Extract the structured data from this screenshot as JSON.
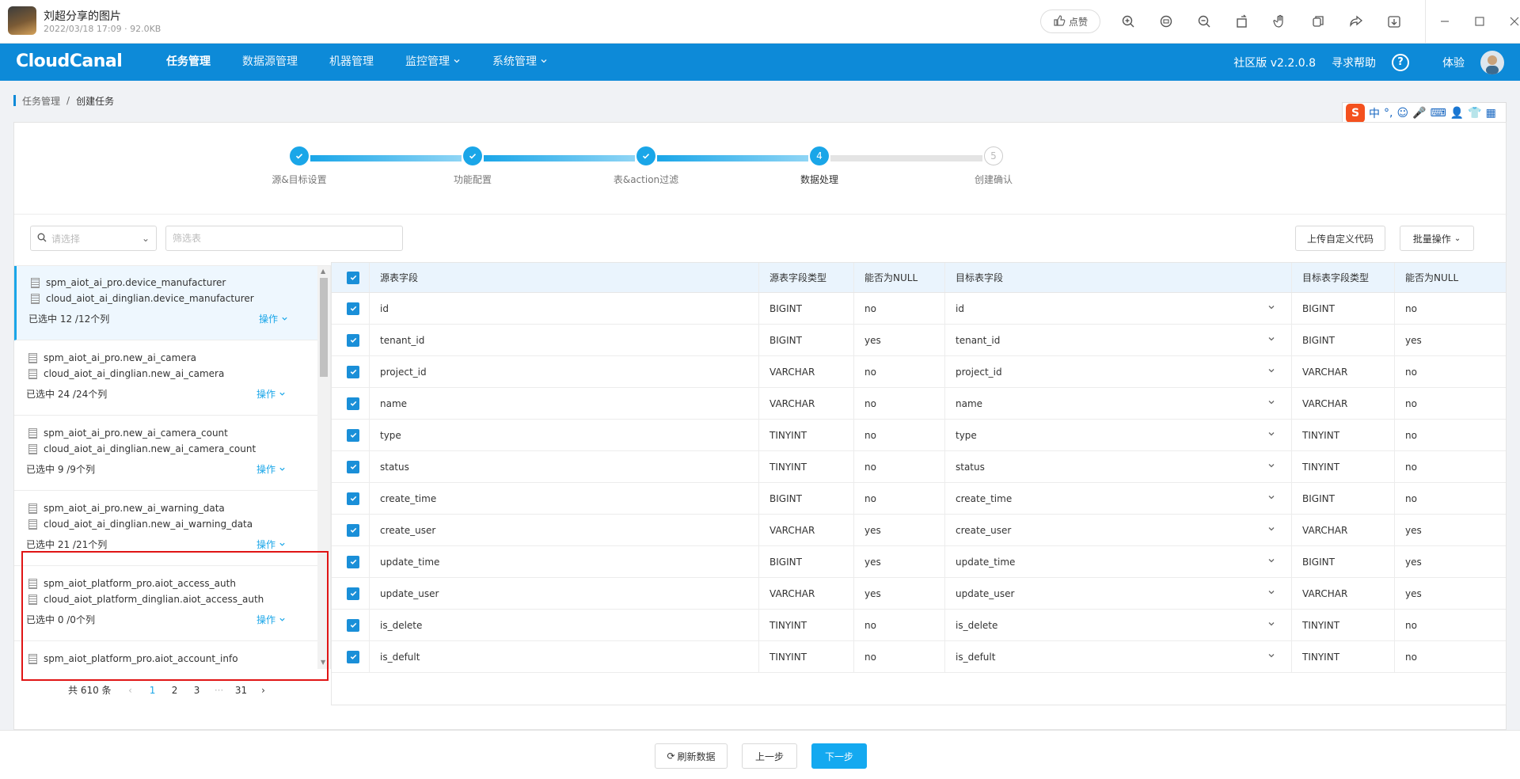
{
  "viewer": {
    "title": "刘超分享的图片",
    "meta": "2022/03/18 17:09 · 92.0KB",
    "like_label": "点赞",
    "tools": [
      "zoom-in-icon",
      "original-size-icon",
      "zoom-out-icon",
      "rotate-icon",
      "hand-icon",
      "copy-icon",
      "share-icon",
      "download-icon"
    ]
  },
  "nav": {
    "logo": "CloudCanal",
    "items": [
      {
        "label": "任务管理",
        "active": true
      },
      {
        "label": "数据源管理"
      },
      {
        "label": "机器管理"
      },
      {
        "label": "监控管理",
        "dropdown": true
      },
      {
        "label": "系统管理",
        "dropdown": true
      }
    ],
    "version": "社区版 v2.2.0.8",
    "help": "寻求帮助",
    "user": "体验"
  },
  "breadcrumb": {
    "parent": "任务管理",
    "separator": "/",
    "current": "创建任务"
  },
  "ime": {
    "logo": "S",
    "lang": "中"
  },
  "steps": [
    {
      "label": "源&目标设置",
      "status": "done"
    },
    {
      "label": "功能配置",
      "status": "done"
    },
    {
      "label": "表&action过滤",
      "status": "done"
    },
    {
      "label": "数据处理",
      "status": "active",
      "num": "4"
    },
    {
      "label": "创建确认",
      "status": "pending",
      "num": "5"
    }
  ],
  "filters": {
    "select_placeholder": "请选择",
    "input_placeholder": "筛选表"
  },
  "actions": {
    "upload": "上传自定义代码",
    "batch": "批量操作"
  },
  "tables": [
    {
      "src": "spm_aiot_ai_pro.device_manufacturer",
      "dst": "cloud_aiot_ai_dinglian.device_manufacturer",
      "count": "已选中 12 /12个列",
      "op": "操作"
    },
    {
      "src": "spm_aiot_ai_pro.new_ai_camera",
      "dst": "cloud_aiot_ai_dinglian.new_ai_camera",
      "count": "已选中 24 /24个列",
      "op": "操作"
    },
    {
      "src": "spm_aiot_ai_pro.new_ai_camera_count",
      "dst": "cloud_aiot_ai_dinglian.new_ai_camera_count",
      "count": "已选中 9 /9个列",
      "op": "操作"
    },
    {
      "src": "spm_aiot_ai_pro.new_ai_warning_data",
      "dst": "cloud_aiot_ai_dinglian.new_ai_warning_data",
      "count": "已选中 21 /21个列",
      "op": "操作"
    },
    {
      "src": "spm_aiot_platform_pro.aiot_access_auth",
      "dst": "cloud_aiot_platform_dinglian.aiot_access_auth",
      "count": "已选中 0 /0个列",
      "op": "操作"
    },
    {
      "src": "spm_aiot_platform_pro.aiot_account_info",
      "dst": "",
      "count": "",
      "op": ""
    }
  ],
  "pager": {
    "total": "共 610 条",
    "pages": [
      "1",
      "2",
      "3",
      "···",
      "31"
    ],
    "prev": "‹",
    "next": "›"
  },
  "grid": {
    "headers": [
      "源表字段",
      "源表字段类型",
      "能否为NULL",
      "目标表字段",
      "目标表字段类型",
      "能否为NULL"
    ],
    "rows": [
      [
        "id",
        "BIGINT",
        "no",
        "id",
        "BIGINT",
        "no"
      ],
      [
        "tenant_id",
        "BIGINT",
        "yes",
        "tenant_id",
        "BIGINT",
        "yes"
      ],
      [
        "project_id",
        "VARCHAR",
        "no",
        "project_id",
        "VARCHAR",
        "no"
      ],
      [
        "name",
        "VARCHAR",
        "no",
        "name",
        "VARCHAR",
        "no"
      ],
      [
        "type",
        "TINYINT",
        "no",
        "type",
        "TINYINT",
        "no"
      ],
      [
        "status",
        "TINYINT",
        "no",
        "status",
        "TINYINT",
        "no"
      ],
      [
        "create_time",
        "BIGINT",
        "no",
        "create_time",
        "BIGINT",
        "no"
      ],
      [
        "create_user",
        "VARCHAR",
        "yes",
        "create_user",
        "VARCHAR",
        "yes"
      ],
      [
        "update_time",
        "BIGINT",
        "yes",
        "update_time",
        "BIGINT",
        "yes"
      ],
      [
        "update_user",
        "VARCHAR",
        "yes",
        "update_user",
        "VARCHAR",
        "yes"
      ],
      [
        "is_delete",
        "TINYINT",
        "no",
        "is_delete",
        "TINYINT",
        "no"
      ],
      [
        "is_defult",
        "TINYINT",
        "no",
        "is_defult",
        "TINYINT",
        "no"
      ]
    ]
  },
  "footer": {
    "refresh": "刷新数据",
    "prev": "上一步",
    "next": "下一步"
  },
  "colors": {
    "nav": "#0d8ad8",
    "accent": "#1aa6e8",
    "primary_button": "#14a9f0",
    "highlight": "#e01515"
  }
}
